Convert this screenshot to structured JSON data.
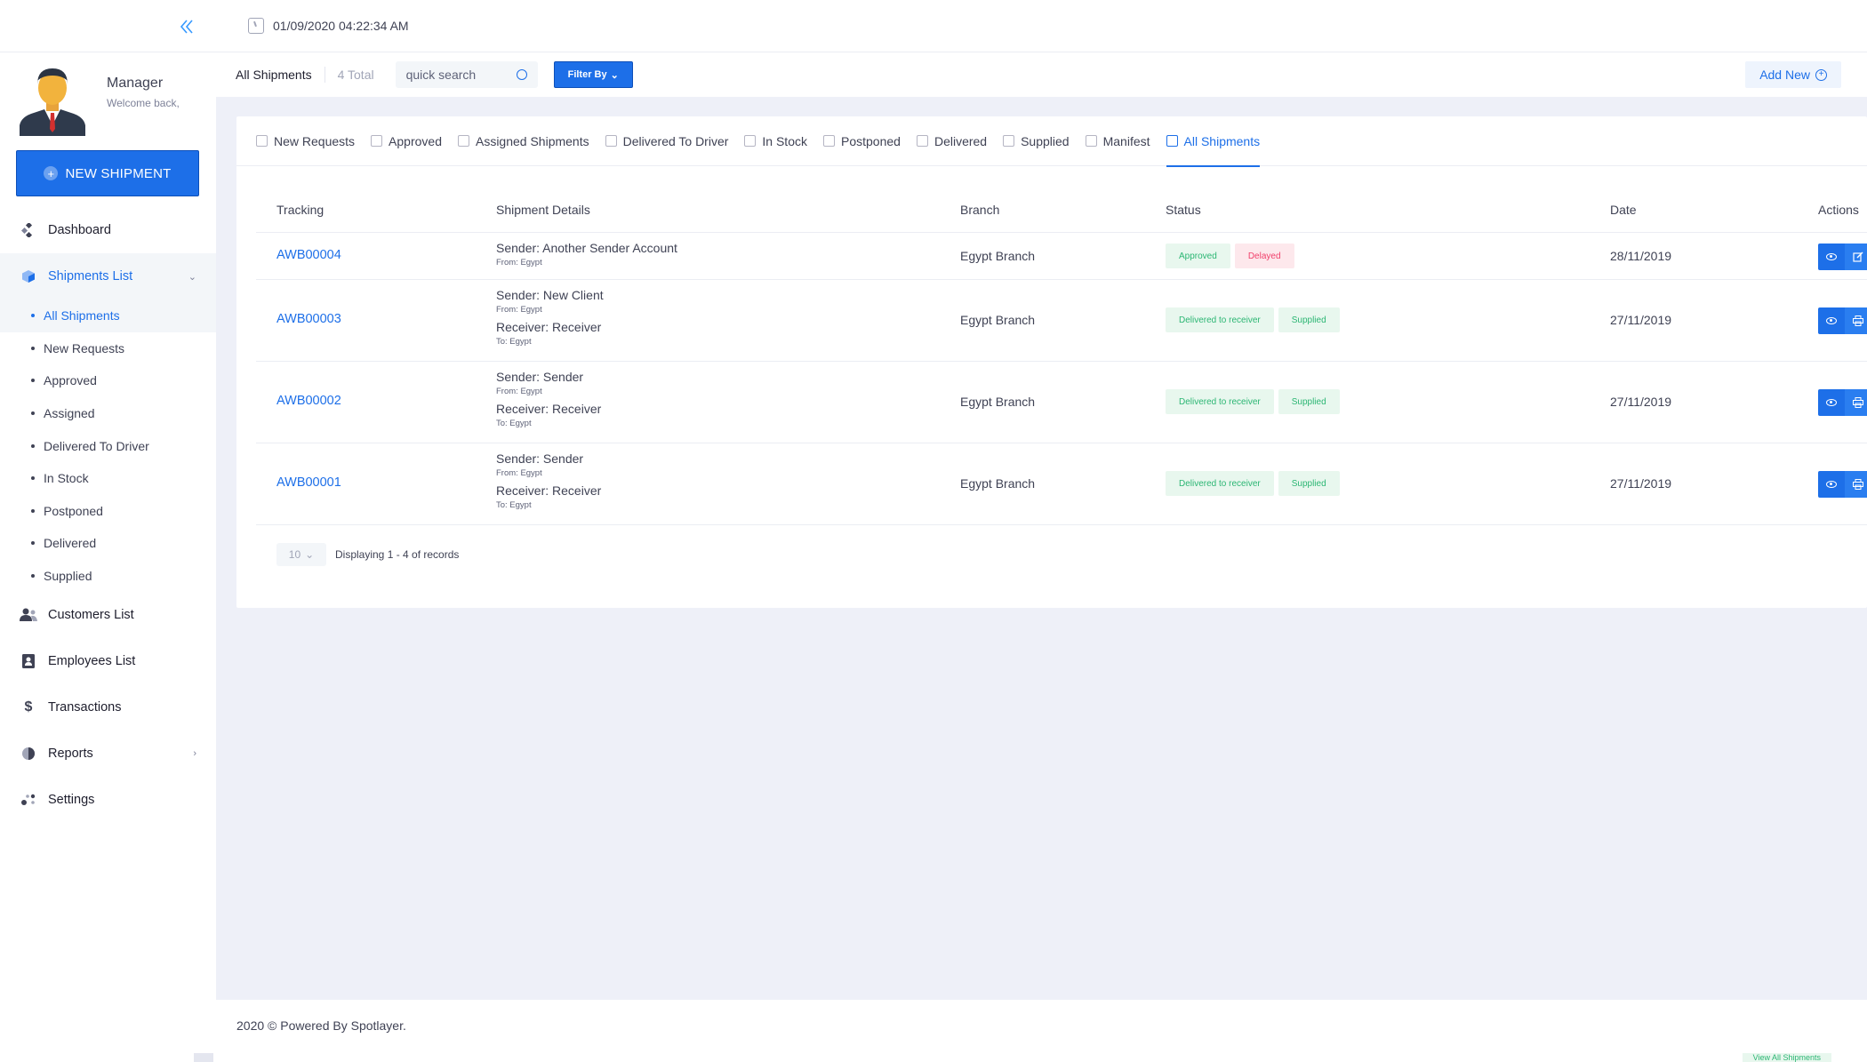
{
  "header": {
    "datetime": "01/09/2020 04:22:34 AM"
  },
  "profile": {
    "name": "Manager",
    "subtitle": "Welcome back,"
  },
  "sidebar": {
    "new_shipment_label": "NEW SHIPMENT",
    "items": [
      {
        "label": "Dashboard"
      },
      {
        "label": "Shipments List"
      },
      {
        "label": "Customers List"
      },
      {
        "label": "Employees List"
      },
      {
        "label": "Transactions"
      },
      {
        "label": "Reports"
      },
      {
        "label": "Settings"
      }
    ],
    "transactions_icon": "$",
    "subitems": [
      {
        "label": "All Shipments"
      },
      {
        "label": "New Requests"
      },
      {
        "label": "Approved"
      },
      {
        "label": "Assigned"
      },
      {
        "label": "Delivered To Driver"
      },
      {
        "label": "In Stock"
      },
      {
        "label": "Postponed"
      },
      {
        "label": "Delivered"
      },
      {
        "label": "Supplied"
      }
    ]
  },
  "subheader": {
    "title": "All Shipments",
    "total": "4 Total",
    "search_placeholder": "quick search",
    "filter_label": "Filter By",
    "add_new_label": "Add New"
  },
  "tabs": [
    {
      "label": "New Requests",
      "icon": "bell-icon"
    },
    {
      "label": "Approved",
      "icon": "thumbs-up-icon"
    },
    {
      "label": "Assigned Shipments",
      "icon": "user-icon"
    },
    {
      "label": "Delivered To Driver",
      "icon": "box-icon"
    },
    {
      "label": "In Stock",
      "icon": "home-icon"
    },
    {
      "label": "Postponed",
      "icon": "clock-icon"
    },
    {
      "label": "Delivered",
      "icon": "package-icon"
    },
    {
      "label": "Supplied",
      "icon": "hand-icon"
    },
    {
      "label": "Manifest",
      "icon": "truck-icon"
    },
    {
      "label": "All Shipments",
      "icon": "basket-icon"
    }
  ],
  "table": {
    "headers": [
      "Tracking",
      "Shipment Details",
      "Branch",
      "Status",
      "Date",
      "Actions"
    ],
    "rows": [
      {
        "tracking": "AWB00004",
        "sender": "Sender: Another Sender Account",
        "from": "From: Egypt",
        "receiver": "",
        "to": "",
        "branch": "Egypt Branch",
        "status1": "Approved",
        "status2": "Delayed",
        "date": "28/11/2019"
      },
      {
        "tracking": "AWB00003",
        "sender": "Sender: New Client",
        "from": "From: Egypt",
        "receiver": "Receiver: Receiver",
        "to": "To: Egypt",
        "branch": "Egypt Branch",
        "status1": "Delivered to receiver",
        "status2": "Supplied",
        "date": "27/11/2019"
      },
      {
        "tracking": "AWB00002",
        "sender": "Sender: Sender",
        "from": "From: Egypt",
        "receiver": "Receiver: Receiver",
        "to": "To: Egypt",
        "branch": "Egypt Branch",
        "status1": "Delivered to receiver",
        "status2": "Supplied",
        "date": "27/11/2019"
      },
      {
        "tracking": "AWB00001",
        "sender": "Sender: Sender",
        "from": "From: Egypt",
        "receiver": "Receiver: Receiver",
        "to": "To: Egypt",
        "branch": "Egypt Branch",
        "status1": "Delivered to receiver",
        "status2": "Supplied",
        "date": "27/11/2019"
      }
    ]
  },
  "pager": {
    "page_size": "10",
    "text": "Displaying 1 - 4 of records"
  },
  "footer": {
    "text": "2020 © Powered By Spotlayer.",
    "link": "View All Shipments"
  },
  "colors": {
    "primary": "#1d6fe8",
    "success": "#2bb673",
    "danger": "#f1416c",
    "background": "#eef0f8"
  }
}
